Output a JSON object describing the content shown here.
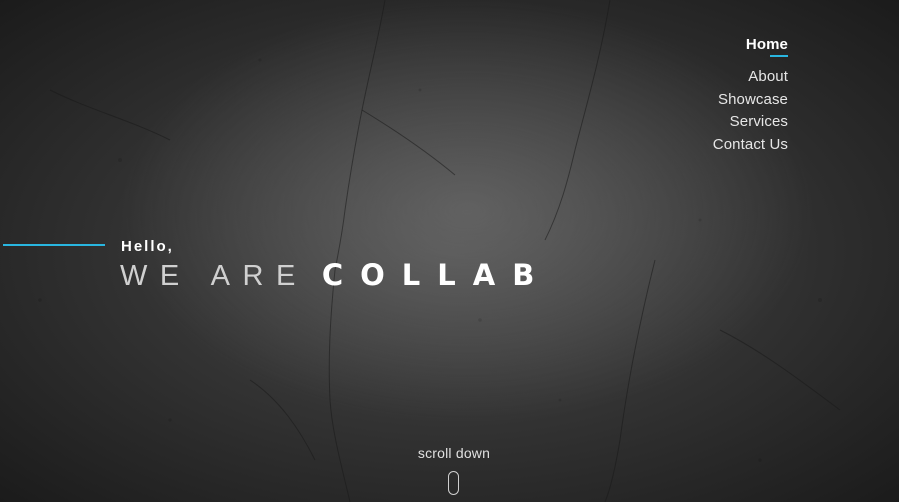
{
  "nav": {
    "items": [
      {
        "label": "Home",
        "active": true
      },
      {
        "label": "About",
        "active": false
      },
      {
        "label": "Showcase",
        "active": false
      },
      {
        "label": "Services",
        "active": false
      },
      {
        "label": "Contact Us",
        "active": false
      }
    ]
  },
  "hero": {
    "greeting": "Hello,",
    "title_prefix": "WE ARE",
    "title_brand": "COLLAB"
  },
  "scroll": {
    "label": "scroll down",
    "icon": "mouse-icon"
  },
  "colors": {
    "accent": "#29b6e0",
    "background": "#2b2b2b",
    "text": "#ffffff"
  }
}
